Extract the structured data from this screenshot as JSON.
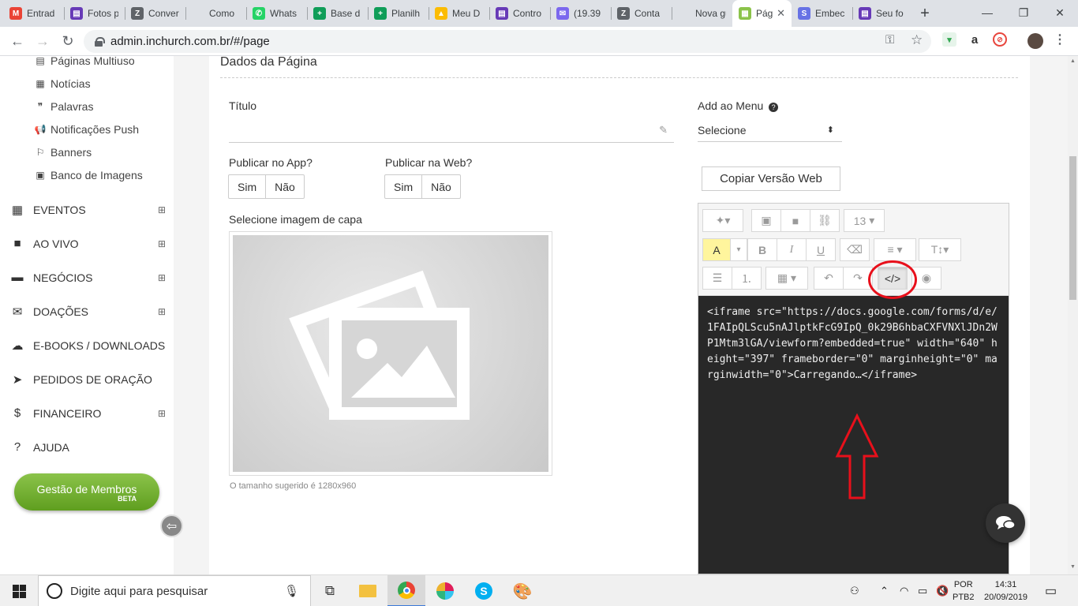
{
  "browser": {
    "tabs": [
      {
        "title": "Entrad",
        "icon": "gmail-icon",
        "color": "#ea4335",
        "glyph": "M"
      },
      {
        "title": "Fotos p",
        "icon": "forms-icon",
        "color": "#673ab7",
        "glyph": "▤"
      },
      {
        "title": "Conver",
        "icon": "zendesk-icon",
        "color": "#5f6368",
        "glyph": "Z"
      },
      {
        "title": "Como",
        "icon": "blank-icon",
        "color": "#dee1e6",
        "glyph": ""
      },
      {
        "title": "Whats",
        "icon": "whatsapp-icon",
        "color": "#25d366",
        "glyph": "✆"
      },
      {
        "title": "Base d",
        "icon": "sheets-icon",
        "color": "#0f9d58",
        "glyph": "+"
      },
      {
        "title": "Planilh",
        "icon": "sheets-icon",
        "color": "#0f9d58",
        "glyph": "+"
      },
      {
        "title": "Meu D",
        "icon": "drive-icon",
        "color": "#fbbc04",
        "glyph": "▲"
      },
      {
        "title": "Contro",
        "icon": "forms-icon",
        "color": "#673ab7",
        "glyph": "▤"
      },
      {
        "title": "(19.39",
        "icon": "mail-icon",
        "color": "#7b68ee",
        "glyph": "✉"
      },
      {
        "title": "Conta",
        "icon": "zendesk-icon",
        "color": "#5f6368",
        "glyph": "Z"
      },
      {
        "title": "Nova guia",
        "icon": "blank-icon",
        "color": "#dee1e6",
        "glyph": ""
      },
      {
        "title": "Pág",
        "icon": "inchurch-icon",
        "color": "#8bc34a",
        "glyph": "▦",
        "active": true
      },
      {
        "title": "Embec",
        "icon": "stripe-icon",
        "color": "#6772e5",
        "glyph": "S"
      },
      {
        "title": "Seu fo",
        "icon": "forms-icon",
        "color": "#673ab7",
        "glyph": "▤"
      }
    ],
    "new_tab": "+",
    "url": "admin.inchurch.com.br/#/page"
  },
  "sidebar": {
    "sub_items": [
      {
        "label": "Páginas Multiuso",
        "icon": "file-icon",
        "glyph": "▤"
      },
      {
        "label": "Notícias",
        "icon": "newspaper-icon",
        "glyph": "▦"
      },
      {
        "label": "Palavras",
        "icon": "quote-icon",
        "glyph": "❞"
      },
      {
        "label": "Notificações Push",
        "icon": "bullhorn-icon",
        "glyph": "📢"
      },
      {
        "label": "Banners",
        "icon": "flag-icon",
        "glyph": "⚐"
      },
      {
        "label": "Banco de Imagens",
        "icon": "image-icon",
        "glyph": "▣"
      }
    ],
    "main_items": [
      {
        "label": "EVENTOS",
        "icon": "calendar-icon",
        "glyph": "▦",
        "expandable": true
      },
      {
        "label": "AO VIVO",
        "icon": "video-icon",
        "glyph": "■",
        "expandable": true
      },
      {
        "label": "NEGÓCIOS",
        "icon": "briefcase-icon",
        "glyph": "▬",
        "expandable": true
      },
      {
        "label": "DOAÇÕES",
        "icon": "envelope-icon",
        "glyph": "✉",
        "expandable": true
      },
      {
        "label": "E-BOOKS / DOWNLOADS",
        "icon": "cloud-download-icon",
        "glyph": "☁",
        "expandable": false
      },
      {
        "label": "PEDIDOS DE ORAÇÃO",
        "icon": "send-icon",
        "glyph": "➤",
        "expandable": false
      },
      {
        "label": "FINANCEIRO",
        "icon": "dollar-icon",
        "glyph": "$",
        "expandable": true
      },
      {
        "label": "AJUDA",
        "icon": "help-icon",
        "glyph": "?",
        "expandable": false
      }
    ],
    "expand_glyph": "⊞",
    "members_button": {
      "label": "Gestão de Membros",
      "badge": "BETA"
    }
  },
  "page": {
    "section_title": "Dados da Página",
    "title_label": "Título",
    "title_value": "",
    "publish_app_label": "Publicar no App?",
    "publish_web_label": "Publicar na Web?",
    "yes": "Sim",
    "no": "Não",
    "cover_label": "Selecione imagem de capa",
    "cover_hint": "O tamanho sugerido é 1280x960",
    "menu_label": "Add ao Menu",
    "menu_help": "?",
    "menu_select": "Selecione",
    "copy_button": "Copiar Versão Web"
  },
  "editor": {
    "font_size": "13",
    "code_view_button": "</>",
    "code": "<iframe src=\"https://docs.google.com/forms/d/e/1FAIpQLScu5nAJlptkFcG9IpQ_0k29B6hbaCXFVNXlJDn2WP1Mtm3lGA/viewform?embedded=true\" width=\"640\" height=\"397\" frameborder=\"0\" marginheight=\"0\" marginwidth=\"0\">Carregando…</iframe>"
  },
  "taskbar": {
    "search_placeholder": "Digite aqui para pesquisar",
    "lang_top": "POR",
    "lang_bottom": "PTB2",
    "time": "14:31",
    "date": "20/09/2019"
  },
  "colors": {
    "accent_green": "#8bc34a",
    "annotation_red": "#e8101b",
    "editor_bg": "#282828"
  }
}
